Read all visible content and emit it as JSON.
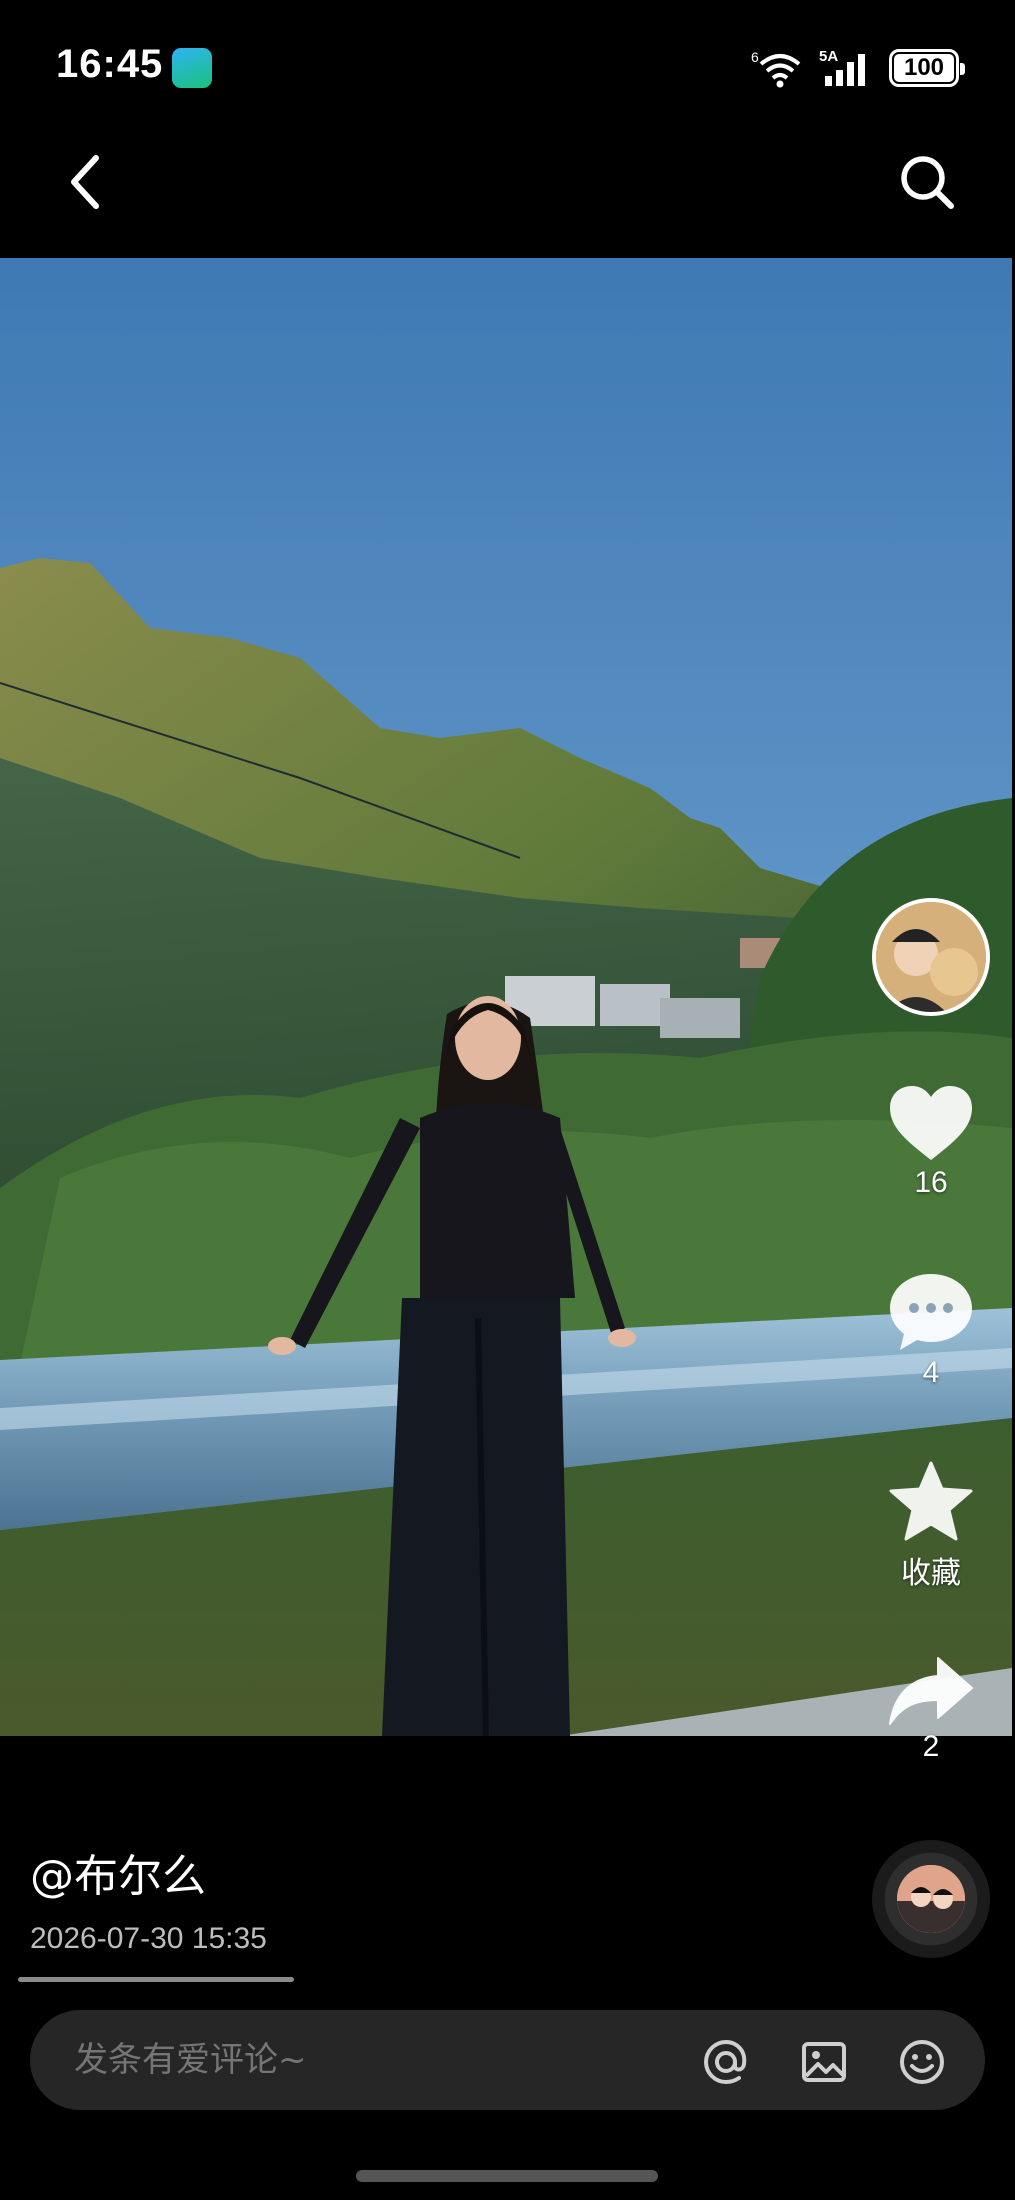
{
  "status_bar": {
    "time": "16:45",
    "app_icon": "network-app-icon",
    "wifi_label": "6",
    "signal_label": "5A",
    "battery": "100"
  },
  "nav": {
    "back_icon": "chevron-left-icon",
    "search_icon": "search-icon"
  },
  "actions": {
    "likes": "16",
    "comments": "4",
    "favorite_label": "收藏",
    "shares": "2"
  },
  "post": {
    "author": "@布尔么",
    "date": "2026-07-30 15:35"
  },
  "comment_bar": {
    "placeholder": "发条有爱评论~",
    "icons": [
      "at-icon",
      "image-icon",
      "emoji-icon"
    ]
  },
  "colors": {
    "background": "#000000",
    "comment_bar": "#262626",
    "sky_top": "#3f79b4",
    "sky_bottom": "#86b7dd"
  }
}
